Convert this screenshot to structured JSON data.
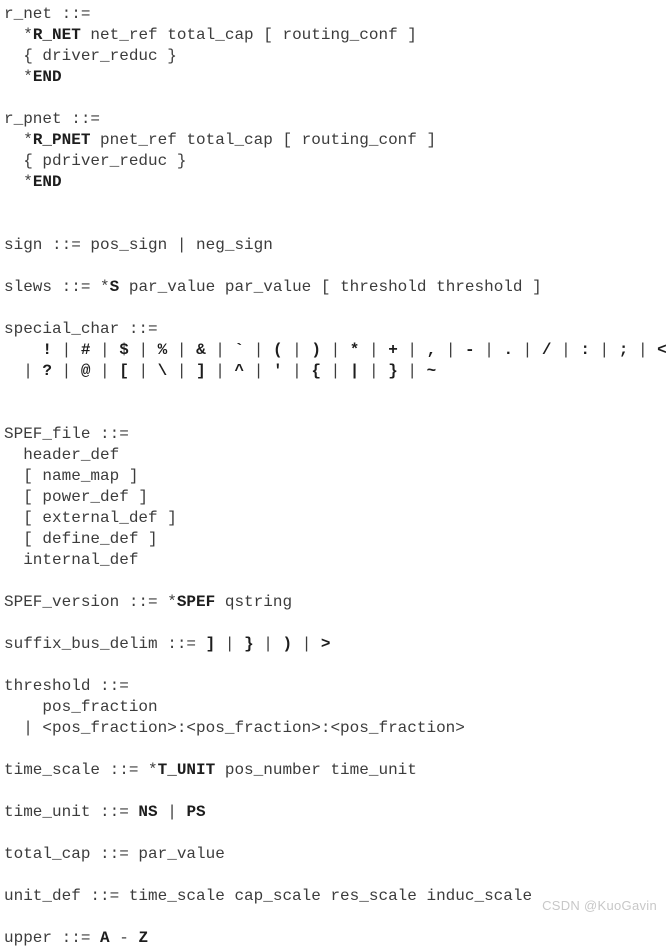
{
  "document": {
    "kind": "bnf-grammar-listing",
    "subject": "SPEF grammar production rules",
    "text_color": "#3c3c3c",
    "bold_color": "#1d1d1d",
    "background_color": "#ffffff"
  },
  "lines": [
    {
      "id": "l01",
      "segments": [
        {
          "t": "r_net ::=",
          "b": false
        }
      ]
    },
    {
      "id": "l02",
      "segments": [
        {
          "t": "  *",
          "b": false
        },
        {
          "t": "R_NET",
          "b": true
        },
        {
          "t": " net_ref total_cap [ routing_conf ]",
          "b": false
        }
      ]
    },
    {
      "id": "l03",
      "segments": [
        {
          "t": "  { driver_reduc }",
          "b": false
        }
      ]
    },
    {
      "id": "l04",
      "segments": [
        {
          "t": "  *",
          "b": false
        },
        {
          "t": "END",
          "b": true
        }
      ]
    },
    {
      "id": "l05",
      "segments": [
        {
          "t": "",
          "b": false
        }
      ]
    },
    {
      "id": "l06",
      "segments": [
        {
          "t": "r_pnet ::=",
          "b": false
        }
      ]
    },
    {
      "id": "l07",
      "segments": [
        {
          "t": "  *",
          "b": false
        },
        {
          "t": "R_PNET",
          "b": true
        },
        {
          "t": " pnet_ref total_cap [ routing_conf ]",
          "b": false
        }
      ]
    },
    {
      "id": "l08",
      "segments": [
        {
          "t": "  { pdriver_reduc }",
          "b": false
        }
      ]
    },
    {
      "id": "l09",
      "segments": [
        {
          "t": "  *",
          "b": false
        },
        {
          "t": "END",
          "b": true
        }
      ]
    },
    {
      "id": "l10",
      "segments": [
        {
          "t": "",
          "b": false
        }
      ]
    },
    {
      "id": "l11",
      "segments": [
        {
          "t": "",
          "b": false
        }
      ]
    },
    {
      "id": "l12",
      "segments": [
        {
          "t": "sign ::= pos_sign | neg_sign",
          "b": false
        }
      ]
    },
    {
      "id": "l13",
      "segments": [
        {
          "t": "",
          "b": false
        }
      ]
    },
    {
      "id": "l14",
      "segments": [
        {
          "t": "slews ::= *",
          "b": false
        },
        {
          "t": "S",
          "b": true
        },
        {
          "t": " par_value par_value [ threshold threshold ]",
          "b": false
        }
      ]
    },
    {
      "id": "l15",
      "segments": [
        {
          "t": "",
          "b": false
        }
      ]
    },
    {
      "id": "l16",
      "segments": [
        {
          "t": "special_char ::=",
          "b": false
        }
      ]
    },
    {
      "id": "l17",
      "segments": [
        {
          "t": "    ",
          "b": false
        },
        {
          "t": "!",
          "b": true
        },
        {
          "t": " | ",
          "b": false
        },
        {
          "t": "#",
          "b": true
        },
        {
          "t": " | ",
          "b": false
        },
        {
          "t": "$",
          "b": true
        },
        {
          "t": " | ",
          "b": false
        },
        {
          "t": "%",
          "b": true
        },
        {
          "t": " | ",
          "b": false
        },
        {
          "t": "&",
          "b": true
        },
        {
          "t": " | ",
          "b": false
        },
        {
          "t": "`",
          "b": true
        },
        {
          "t": " | ",
          "b": false
        },
        {
          "t": "(",
          "b": true
        },
        {
          "t": " | ",
          "b": false
        },
        {
          "t": ")",
          "b": true
        },
        {
          "t": " | ",
          "b": false
        },
        {
          "t": "*",
          "b": true
        },
        {
          "t": " | ",
          "b": false
        },
        {
          "t": "+",
          "b": true
        },
        {
          "t": " | ",
          "b": false
        },
        {
          "t": ",",
          "b": true
        },
        {
          "t": " | ",
          "b": false
        },
        {
          "t": "-",
          "b": true
        },
        {
          "t": " | ",
          "b": false
        },
        {
          "t": ".",
          "b": true
        },
        {
          "t": " | ",
          "b": false
        },
        {
          "t": "/",
          "b": true
        },
        {
          "t": " | ",
          "b": false
        },
        {
          "t": ":",
          "b": true
        },
        {
          "t": " | ",
          "b": false
        },
        {
          "t": ";",
          "b": true
        },
        {
          "t": " | ",
          "b": false
        },
        {
          "t": "<",
          "b": true
        },
        {
          "t": " | ",
          "b": false
        },
        {
          "t": "=",
          "b": true
        },
        {
          "t": "| ",
          "b": false
        },
        {
          "t": ">",
          "b": true
        }
      ]
    },
    {
      "id": "l18",
      "segments": [
        {
          "t": "  | ",
          "b": false
        },
        {
          "t": "?",
          "b": true
        },
        {
          "t": " | ",
          "b": false
        },
        {
          "t": "@",
          "b": true
        },
        {
          "t": " | ",
          "b": false
        },
        {
          "t": "[",
          "b": true
        },
        {
          "t": " | ",
          "b": false
        },
        {
          "t": "\\",
          "b": true
        },
        {
          "t": " | ",
          "b": false
        },
        {
          "t": "]",
          "b": true
        },
        {
          "t": " | ",
          "b": false
        },
        {
          "t": "^",
          "b": true
        },
        {
          "t": " | ",
          "b": false
        },
        {
          "t": "'",
          "b": true
        },
        {
          "t": " | ",
          "b": false
        },
        {
          "t": "{",
          "b": true
        },
        {
          "t": " | ",
          "b": false
        },
        {
          "t": "|",
          "b": true
        },
        {
          "t": " | ",
          "b": false
        },
        {
          "t": "}",
          "b": true
        },
        {
          "t": " | ",
          "b": false
        },
        {
          "t": "~",
          "b": true
        }
      ]
    },
    {
      "id": "l19",
      "segments": [
        {
          "t": "",
          "b": false
        }
      ]
    },
    {
      "id": "l20",
      "segments": [
        {
          "t": "",
          "b": false
        }
      ]
    },
    {
      "id": "l21",
      "segments": [
        {
          "t": "SPEF_file ::=",
          "b": false
        }
      ]
    },
    {
      "id": "l22",
      "segments": [
        {
          "t": "  header_def",
          "b": false
        }
      ]
    },
    {
      "id": "l23",
      "segments": [
        {
          "t": "  [ name_map ]",
          "b": false
        }
      ]
    },
    {
      "id": "l24",
      "segments": [
        {
          "t": "  [ power_def ]",
          "b": false
        }
      ]
    },
    {
      "id": "l25",
      "segments": [
        {
          "t": "  [ external_def ]",
          "b": false
        }
      ]
    },
    {
      "id": "l26",
      "segments": [
        {
          "t": "  [ define_def ]",
          "b": false
        }
      ]
    },
    {
      "id": "l27",
      "segments": [
        {
          "t": "  internal_def",
          "b": false
        }
      ]
    },
    {
      "id": "l28",
      "segments": [
        {
          "t": "",
          "b": false
        }
      ]
    },
    {
      "id": "l29",
      "segments": [
        {
          "t": "SPEF_version ::= *",
          "b": false
        },
        {
          "t": "SPEF",
          "b": true
        },
        {
          "t": " qstring",
          "b": false
        }
      ]
    },
    {
      "id": "l30",
      "segments": [
        {
          "t": "",
          "b": false
        }
      ]
    },
    {
      "id": "l31",
      "segments": [
        {
          "t": "suffix_bus_delim ::= ",
          "b": false
        },
        {
          "t": "]",
          "b": true
        },
        {
          "t": " | ",
          "b": false
        },
        {
          "t": "}",
          "b": true
        },
        {
          "t": " | ",
          "b": false
        },
        {
          "t": ")",
          "b": true
        },
        {
          "t": " | ",
          "b": false
        },
        {
          "t": ">",
          "b": true
        }
      ]
    },
    {
      "id": "l32",
      "segments": [
        {
          "t": "",
          "b": false
        }
      ]
    },
    {
      "id": "l33",
      "segments": [
        {
          "t": "threshold ::=",
          "b": false
        }
      ]
    },
    {
      "id": "l34",
      "segments": [
        {
          "t": "    pos_fraction",
          "b": false
        }
      ]
    },
    {
      "id": "l35",
      "segments": [
        {
          "t": "  | <pos_fraction>:<pos_fraction>:<pos_fraction>",
          "b": false
        }
      ]
    },
    {
      "id": "l36",
      "segments": [
        {
          "t": "",
          "b": false
        }
      ]
    },
    {
      "id": "l37",
      "segments": [
        {
          "t": "time_scale ::= *",
          "b": false
        },
        {
          "t": "T_UNIT",
          "b": true
        },
        {
          "t": " pos_number time_unit",
          "b": false
        }
      ]
    },
    {
      "id": "l38",
      "segments": [
        {
          "t": "",
          "b": false
        }
      ]
    },
    {
      "id": "l39",
      "segments": [
        {
          "t": "time_unit ::= ",
          "b": false
        },
        {
          "t": "NS",
          "b": true
        },
        {
          "t": " | ",
          "b": false
        },
        {
          "t": "PS",
          "b": true
        }
      ]
    },
    {
      "id": "l40",
      "segments": [
        {
          "t": "",
          "b": false
        }
      ]
    },
    {
      "id": "l41",
      "segments": [
        {
          "t": "total_cap ::= par_value",
          "b": false
        }
      ]
    },
    {
      "id": "l42",
      "segments": [
        {
          "t": "",
          "b": false
        }
      ]
    },
    {
      "id": "l43",
      "segments": [
        {
          "t": "unit_def ::= time_scale cap_scale res_scale induc_scale",
          "b": false
        }
      ]
    },
    {
      "id": "l44",
      "segments": [
        {
          "t": "",
          "b": false
        }
      ]
    },
    {
      "id": "l45",
      "segments": [
        {
          "t": "upper ::= ",
          "b": false
        },
        {
          "t": "A",
          "b": true
        },
        {
          "t": " - ",
          "b": false
        },
        {
          "t": "Z",
          "b": true
        }
      ]
    }
  ],
  "watermark": {
    "text": "CSDN @KuoGavin"
  }
}
